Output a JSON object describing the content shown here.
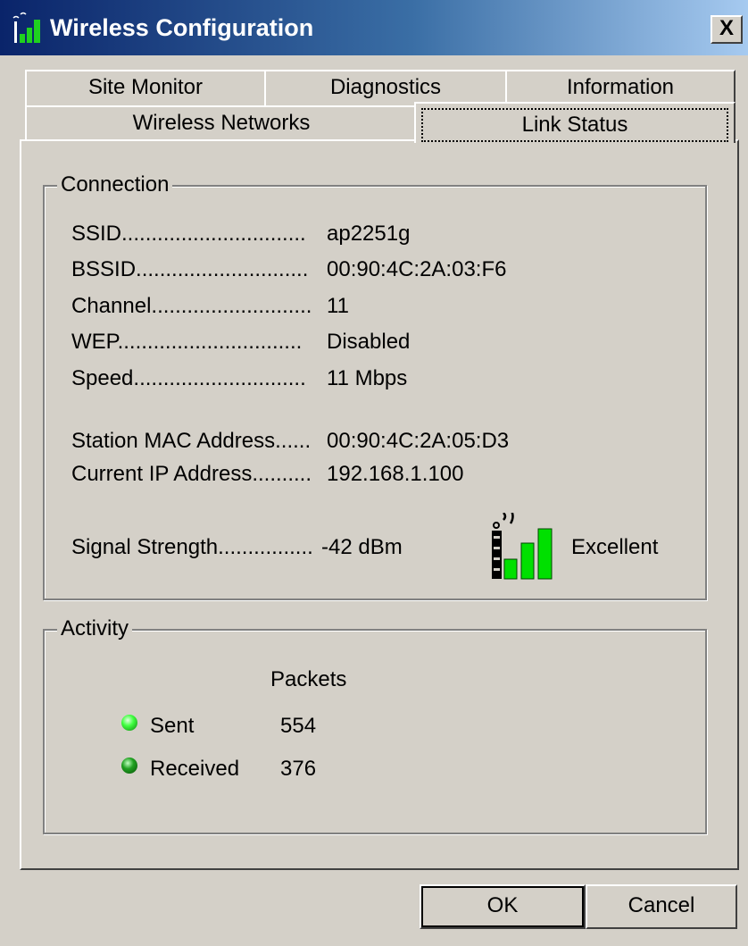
{
  "window": {
    "title": "Wireless Configuration",
    "close_label": "X"
  },
  "tabs": [
    {
      "label": "Site Monitor",
      "selected": false
    },
    {
      "label": "Diagnostics",
      "selected": false
    },
    {
      "label": "Information",
      "selected": false
    },
    {
      "label": "Wireless Networks",
      "selected": false
    },
    {
      "label": "Link Status",
      "selected": true
    }
  ],
  "connection": {
    "title": "Connection",
    "ssid": {
      "label": "SSID...............................",
      "value": "ap2251g"
    },
    "bssid": {
      "label": "BSSID.............................",
      "value": "00:90:4C:2A:03:F6"
    },
    "channel": {
      "label": "Channel...........................",
      "value": "11"
    },
    "wep": {
      "label": "WEP...............................",
      "value": "Disabled"
    },
    "speed": {
      "label": "Speed.............................",
      "value": "11 Mbps"
    },
    "station_mac": {
      "label": "Station MAC Address......",
      "value": "00:90:4C:2A:05:D3"
    },
    "current_ip": {
      "label": "Current IP Address..........",
      "value": "192.168.1.100"
    },
    "signal": {
      "label": "Signal Strength................",
      "value": "-42 dBm",
      "quality": "Excellent",
      "bars_lit": 3,
      "bars_total": 3,
      "icon": "signal-strength-icon"
    }
  },
  "activity": {
    "title": "Activity",
    "packets_header": "Packets",
    "sent": {
      "label": "Sent",
      "value": "554",
      "led_color": "#40ff40"
    },
    "received": {
      "label": "Received",
      "value": "376",
      "led_color": "#20a020"
    }
  },
  "buttons": {
    "ok": "OK",
    "cancel": "Cancel"
  },
  "colors": {
    "titlebar": "#0a246a",
    "face": "#d4d0c8",
    "signal_green": "#00e000"
  }
}
